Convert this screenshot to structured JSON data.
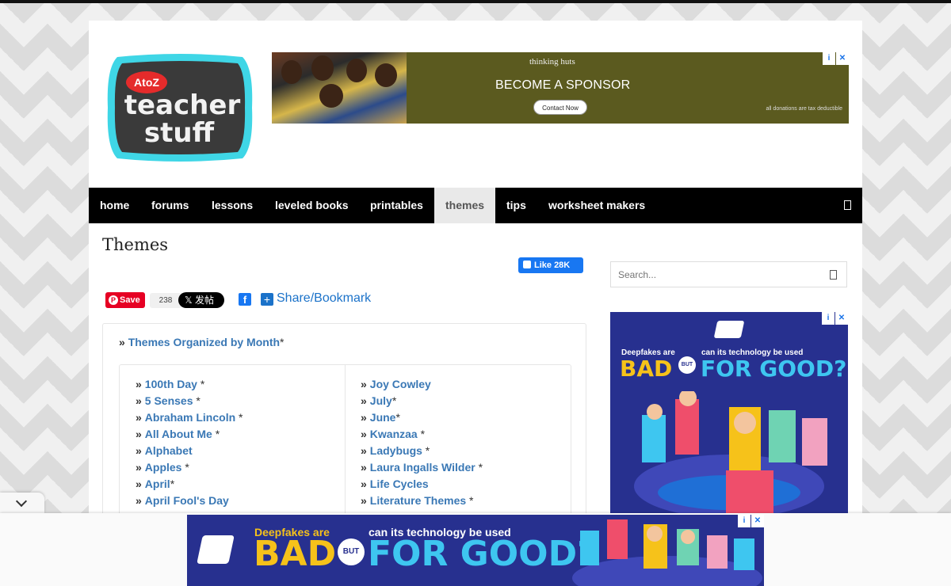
{
  "logo": {
    "small_text": "AtoZ",
    "line1": "teacher",
    "line2": "stuff"
  },
  "top_ad": {
    "brand": "thinking huts",
    "headline": "BECOME A SPONSOR",
    "cta": "Contact Now",
    "fineprint": "all donations are tax deductible"
  },
  "nav": {
    "items": [
      {
        "label": "home"
      },
      {
        "label": "forums"
      },
      {
        "label": "lessons"
      },
      {
        "label": "leveled books"
      },
      {
        "label": "printables"
      },
      {
        "label": "themes",
        "active": true
      },
      {
        "label": "tips"
      },
      {
        "label": "worksheet makers"
      }
    ]
  },
  "page": {
    "title": "Themes",
    "fb_like": "Like 28K"
  },
  "share": {
    "pin_save": "Save",
    "pin_count": "238",
    "x_post": "发帖",
    "bookmark": "Share/Bookmark"
  },
  "content": {
    "raquo": "»",
    "month_link": "Themes Organized by Month",
    "month_star": "*",
    "left_list": [
      {
        "label": "100th Day",
        "suffix": " *"
      },
      {
        "label": "5 Senses",
        "suffix": " *"
      },
      {
        "label": "Abraham Lincoln",
        "suffix": " *"
      },
      {
        "label": "All About Me",
        "suffix": " *"
      },
      {
        "label": "Alphabet",
        "suffix": ""
      },
      {
        "label": "Apples",
        "suffix": " *"
      },
      {
        "label": "April",
        "suffix": "*"
      },
      {
        "label": "April Fool's Day",
        "suffix": ""
      }
    ],
    "right_list": [
      {
        "label": "Joy Cowley",
        "suffix": ""
      },
      {
        "label": "July",
        "suffix": "*"
      },
      {
        "label": "June",
        "suffix": "*"
      },
      {
        "label": "Kwanzaa",
        "suffix": " *"
      },
      {
        "label": "Ladybugs",
        "suffix": " *"
      },
      {
        "label": "Laura Ingalls Wilder",
        "suffix": " *"
      },
      {
        "label": "Life Cycles",
        "suffix": ""
      },
      {
        "label": "Literature Themes",
        "suffix": " *"
      }
    ]
  },
  "sidebar": {
    "search_placeholder": "Search..."
  },
  "side_ad": {
    "line1a": "Deepfakes are",
    "line1b": "can its technology be used",
    "bad": "BAD",
    "but": "BUT",
    "good": "FOR GOOD?"
  },
  "bottom_ad": {
    "line1a": "Deepfakes are",
    "line1b": "can its technology be used",
    "bad": "BAD",
    "but": "BUT",
    "good": "FOR GOOD?"
  },
  "colors": {
    "link": "#3a78b5",
    "nav_bg": "#000000",
    "ad_navy": "#27308f",
    "ad_yellow": "#f6c21a",
    "ad_cyan": "#3ec6f0"
  }
}
